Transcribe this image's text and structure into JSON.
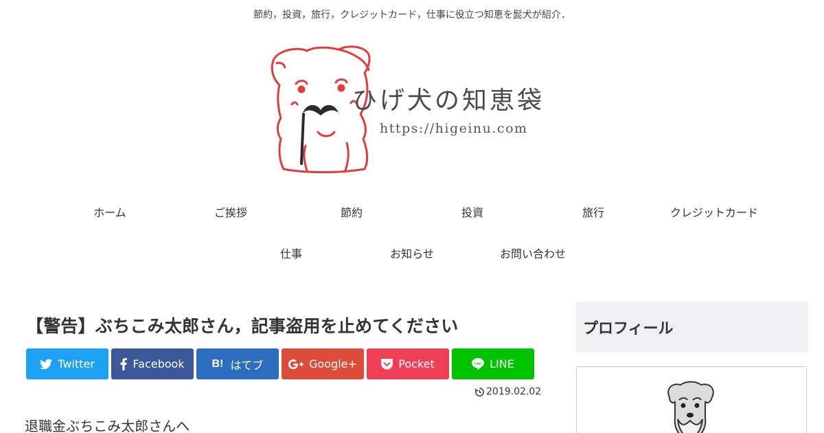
{
  "header": {
    "tagline": "節約，投資，旅行，クレジットカード，仕事に役立つ知恵を髭犬が紹介．",
    "logo": {
      "title": "ひげ犬の知恵袋",
      "url": "https://higeinu.com"
    }
  },
  "nav": {
    "row1": [
      {
        "label": "ホーム"
      },
      {
        "label": "ご挨拶"
      },
      {
        "label": "節約"
      },
      {
        "label": "投資"
      },
      {
        "label": "旅行"
      },
      {
        "label": "クレジットカード"
      }
    ],
    "row2": [
      {
        "label": "仕事"
      },
      {
        "label": "お知らせ"
      },
      {
        "label": "お問い合わせ"
      }
    ]
  },
  "article": {
    "title": "【警告】ぶちこみ太郎さん，記事盗用を止めてください",
    "date": "2019.02.02",
    "lead": "退職金ぶちこみ太郎さんへ"
  },
  "share": {
    "twitter": "Twitter",
    "facebook": "Facebook",
    "hatena": "はてブ",
    "google": "Google+",
    "pocket": "Pocket",
    "line": "LINE",
    "hatena_mark": "B!",
    "colors": {
      "twitter": "#1da1f2",
      "facebook": "#3b5998",
      "hatena": "#2c6ebd",
      "google": "#dd4b39",
      "pocket": "#ef3f56",
      "line": "#00c300"
    }
  },
  "sidebar": {
    "profile_heading": "プロフィール"
  },
  "icons": {
    "date": "history-icon",
    "logo_mascot": "mustache-dog-illustration"
  }
}
